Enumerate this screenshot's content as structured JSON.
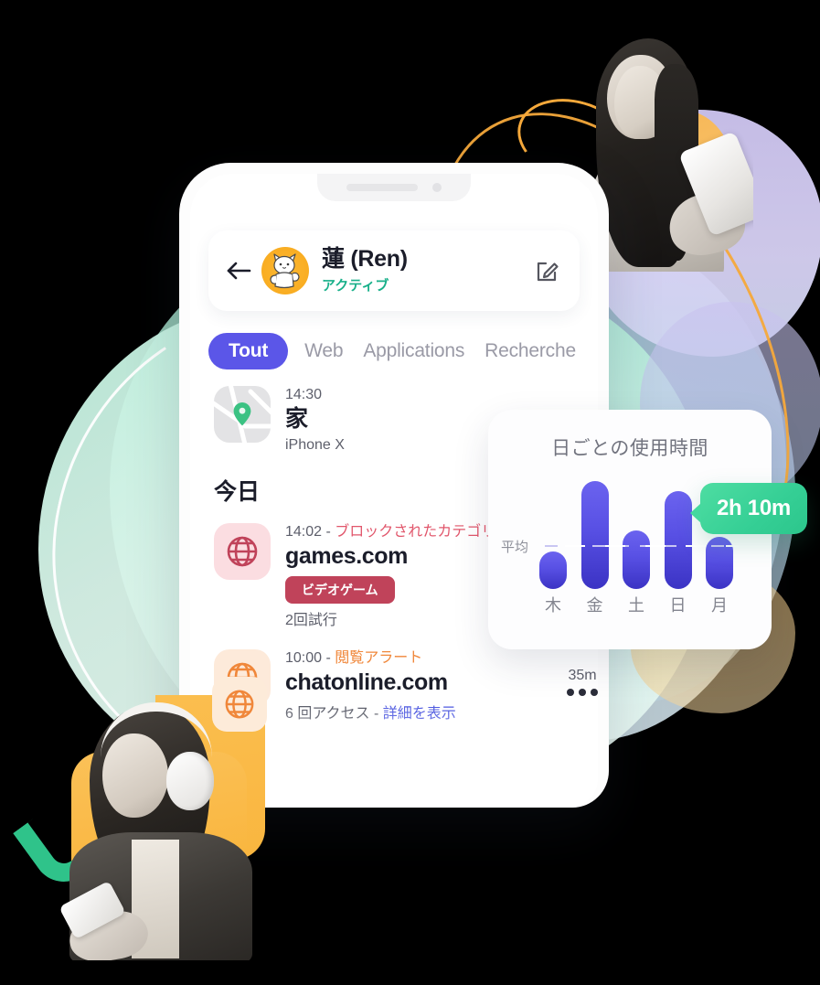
{
  "header": {
    "back_icon": "arrow-left-icon",
    "avatar_icon": "cat-avatar",
    "name": "蓮 (Ren)",
    "status": "アクティブ",
    "edit_icon": "edit-compose-icon"
  },
  "tabs": [
    {
      "label": "Tout",
      "active": true
    },
    {
      "label": "Web",
      "active": false
    },
    {
      "label": "Applications",
      "active": false
    },
    {
      "label": "Recherche",
      "active": false
    }
  ],
  "location_entry": {
    "icon": "map-pin-icon",
    "time": "14:30",
    "title": "家",
    "device": "iPhone X"
  },
  "section": {
    "today_label": "今日"
  },
  "activity": [
    {
      "icon": "globe-icon",
      "time": "14:02",
      "separator": " - ",
      "alert": "ブロックされたカテゴリー",
      "alert_color": "#e1566b",
      "title": "games.com",
      "badge": "ビデオゲーム",
      "sub": "2回試行",
      "duration": "",
      "more_icon": ""
    },
    {
      "icon": "globe-icon",
      "time": "10:00",
      "separator": " - ",
      "alert": "閲覧アラート",
      "alert_color": "#f0873a",
      "title": "chatonline.com",
      "badge": "",
      "sub_prefix": "6 回アクセス - ",
      "sub_link": "詳細を表示",
      "duration": "35m",
      "more_icon": "more-dots-icon"
    }
  ],
  "chart_data": {
    "type": "bar",
    "title": "日ごとの使用時間",
    "categories": [
      "木",
      "金",
      "土",
      "日",
      "月"
    ],
    "values": [
      53,
      152,
      83,
      138,
      73
    ],
    "unit": "minutes",
    "average_label": "平均",
    "average_value": 130,
    "tooltip": "2h 10m",
    "ylim": [
      0,
      165
    ],
    "xlabel": "",
    "ylabel": "",
    "grid": false,
    "legend": "none",
    "bar_color_top": "#6b63ef",
    "bar_color_bottom": "#3b33c4",
    "tooltip_color": "#35cf95"
  },
  "theme": {
    "accent_purple": "#5b56e8",
    "accent_green": "#19b08a",
    "alert_red": "#e1566b",
    "alert_orange": "#f0873a",
    "link_blue": "#4f5ae0",
    "badge_red": "#c0435a"
  }
}
